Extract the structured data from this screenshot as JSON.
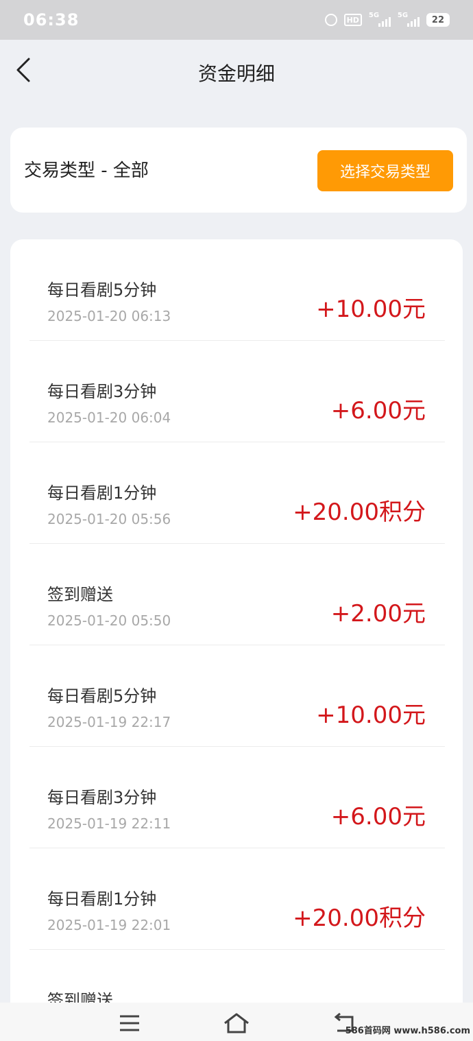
{
  "status_bar": {
    "time": "06:38",
    "hd_label": "HD",
    "signal1_label": "5G",
    "signal2_label": "5G",
    "battery": "22",
    "icons": [
      "alarm-icon",
      "hd-icon",
      "signal-icon",
      "signal-icon",
      "battery-icon"
    ]
  },
  "header": {
    "title": "资金明细",
    "back_icon": "chevron-left-icon"
  },
  "filter": {
    "label": "交易类型 - 全部",
    "button_label": "选择交易类型",
    "button_color": "#ff9a05"
  },
  "transactions": [
    {
      "title": "每日看剧5分钟",
      "time": "2025-01-20 06:13",
      "amount": "+10.00元"
    },
    {
      "title": "每日看剧3分钟",
      "time": "2025-01-20 06:04",
      "amount": "+6.00元"
    },
    {
      "title": "每日看剧1分钟",
      "time": "2025-01-20 05:56",
      "amount": "+20.00积分"
    },
    {
      "title": "签到赠送",
      "time": "2025-01-20 05:50",
      "amount": "+2.00元"
    },
    {
      "title": "每日看剧5分钟",
      "time": "2025-01-19 22:17",
      "amount": "+10.00元"
    },
    {
      "title": "每日看剧3分钟",
      "time": "2025-01-19 22:11",
      "amount": "+6.00元"
    },
    {
      "title": "每日看剧1分钟",
      "time": "2025-01-19 22:01",
      "amount": "+20.00积分"
    },
    {
      "title": "签到赠送",
      "time": "",
      "amount": ""
    }
  ],
  "amount_color": "#d3171b",
  "nav": {
    "icons": [
      "menu-icon",
      "home-icon",
      "back-icon"
    ]
  },
  "watermark": "586首码网 www.h586.com"
}
